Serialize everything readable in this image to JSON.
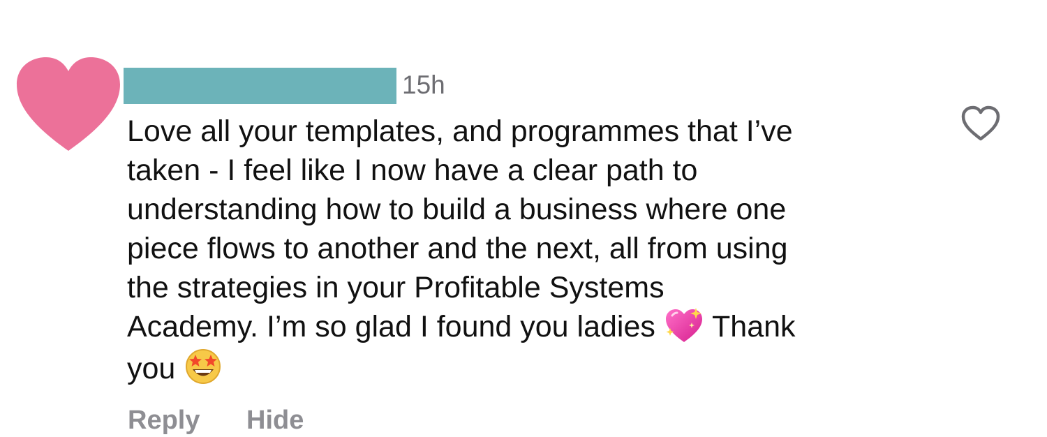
{
  "comment": {
    "timestamp": "15h",
    "lines": [
      "Love all your templates, and programmes that I’ve",
      "taken - I feel like I now have a clear path to",
      "understanding how to build a business where one",
      "piece flows to another and the next, all from using",
      "the strategies in your Profitable Systems"
    ],
    "line6_before_emoji": "Academy. I’m so glad I found you ladies ",
    "line6_after_emoji": " Thank",
    "line7_before_emoji": "you ",
    "icons": {
      "avatar": "pink-heart-avatar-icon",
      "sparkling_heart": "sparkling-heart-emoji-icon",
      "star_struck": "star-struck-emoji-icon",
      "like": "heart-outline-icon"
    },
    "colors": {
      "avatar_pink": "#ec7199",
      "redaction_teal": "#6cb3b9",
      "meta_gray": "#8e8e93"
    }
  },
  "actions": {
    "reply_label": "Reply",
    "hide_label": "Hide"
  }
}
